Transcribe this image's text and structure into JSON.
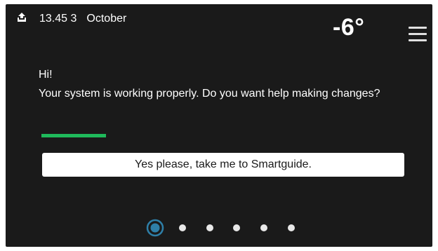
{
  "status": {
    "icon": "upload-arrow-icon",
    "time": "13.45",
    "day": "3",
    "month": "October"
  },
  "header": {
    "temperature": "-6°",
    "menu_icon": "hamburger-menu-icon"
  },
  "main": {
    "greeting": "Hi!",
    "message": "Your system is working properly. Do you want help making changes?",
    "cta_label": "Yes please, take me to Smartguide."
  },
  "pager": {
    "page_count": 6,
    "current_page": 1
  },
  "colors": {
    "background": "#1a1a1a",
    "accent": "#1fba5b",
    "active_dot": "#2e7fa8",
    "text": "#ffffff"
  }
}
